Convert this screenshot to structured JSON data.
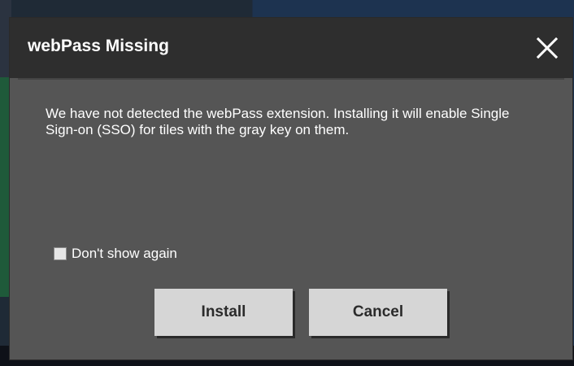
{
  "dialog": {
    "title": "webPass Missing",
    "close_icon": "close-icon",
    "message": "We have not detected the webPass extension. Installing it will enable Single Sign-on (SSO) for tiles with the gray key on them.",
    "checkbox": {
      "label": "Don't show again",
      "checked": false
    },
    "buttons": {
      "install_label": "Install",
      "cancel_label": "Cancel"
    }
  },
  "colors": {
    "titlebar": "#2e2e2e",
    "body": "#555555",
    "button": "#d6d6d6",
    "text": "#ffffff",
    "button_text": "#2b2b2b"
  }
}
